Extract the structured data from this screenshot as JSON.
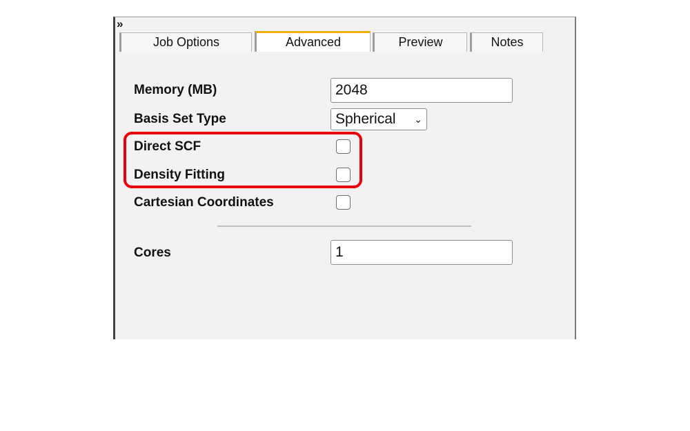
{
  "header": {
    "expand_glyph": "»"
  },
  "tabs": [
    {
      "label": "Job Options",
      "active": false
    },
    {
      "label": "Advanced",
      "active": true
    },
    {
      "label": "Preview",
      "active": false
    },
    {
      "label": "Notes",
      "active": false
    }
  ],
  "form": {
    "memory": {
      "label": "Memory (MB)",
      "value": "2048"
    },
    "basis_set_type": {
      "label": "Basis Set Type",
      "selected": "Spherical"
    },
    "direct_scf": {
      "label": "Direct SCF",
      "checked": false
    },
    "density_fitting": {
      "label": "Density Fitting",
      "checked": false
    },
    "cartesian_coordinates": {
      "label": "Cartesian Coordinates",
      "checked": false
    },
    "cores": {
      "label": "Cores",
      "value": "1"
    }
  },
  "colors": {
    "active_tab_accent": "#f0b000",
    "highlight_box": "#e8000d",
    "panel_background": "#f2f2f2"
  }
}
